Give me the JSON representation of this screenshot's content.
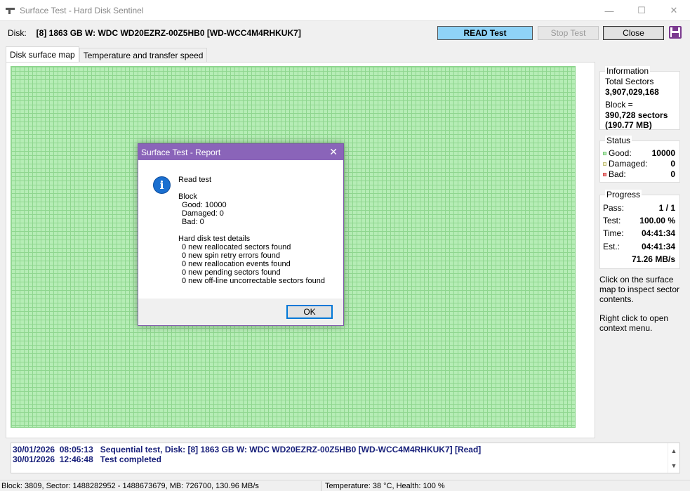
{
  "window": {
    "title": "Surface Test - Hard Disk Sentinel",
    "minimize": "—",
    "maximize": "☐",
    "close": "✕"
  },
  "disk": {
    "label": "Disk:",
    "name": "[8] 1863 GB W: WDC WD20EZRZ-00Z5HB0 [WD-WCC4M4RHKUK7]"
  },
  "toolbar": {
    "read_label": "READ Test",
    "stop_label": "Stop Test",
    "close_label": "Close"
  },
  "tabs": [
    {
      "label": "Disk surface map",
      "active": true
    },
    {
      "label": "Temperature and transfer speed",
      "active": false
    }
  ],
  "information": {
    "title": "Information",
    "total_label": "Total Sectors",
    "total_value": "3,907,029,168",
    "block_label": "Block =",
    "block_sectors": "390,728 sectors",
    "block_size": "(190.77 MB)"
  },
  "status": {
    "title": "Status",
    "good_label": "Good:",
    "good_value": "10000",
    "damaged_label": "Damaged:",
    "damaged_value": "0",
    "bad_label": "Bad:",
    "bad_value": "0"
  },
  "progress": {
    "title": "Progress",
    "pass_label": "Pass:",
    "pass_value": "1 / 1",
    "test_label": "Test:",
    "test_value": "100.00 %",
    "time_label": "Time:",
    "time_value": "04:41:34",
    "est_label": "Est.:",
    "est_value": "04:41:34",
    "speed": "71.26 MB/s"
  },
  "hints": {
    "click": "Click on the surface map to inspect sector contents.",
    "right_click": "Right click to open context menu."
  },
  "log": [
    {
      "date": "30/01/2026",
      "time": "08:05:13",
      "message": "Sequential test, Disk: [8] 1863 GB W: WDC WD20EZRZ-00Z5HB0 [WD-WCC4M4RHKUK7] [Read]"
    },
    {
      "date": "30/01/2026",
      "time": "12:46:48",
      "message": "Test completed"
    }
  ],
  "statusbar": {
    "left": "Block: 3809, Sector: 1488282952 - 1488673679, MB: 726700, 130.96 MB/s",
    "right": "Temperature: 38  °C,  Health: 100 %"
  },
  "dialog": {
    "title": "Surface Test - Report",
    "icon_glyph": "i",
    "heading": "Read test",
    "block_label": "Block",
    "good": "Good: 10000",
    "damaged": "Damaged: 0",
    "bad": "Bad: 0",
    "details_label": "Hard disk test details",
    "details": [
      "0 new reallocated sectors found",
      "0 new spin retry errors found",
      "0 new reallocation events found",
      "0 new pending sectors found",
      "0 new off-line uncorrectable sectors found"
    ],
    "ok_label": "OK"
  },
  "colors": {
    "good": "#b6edb6",
    "damaged": "#f7f2c6",
    "bad": "#f08a8a",
    "read_button": "#8fd3f7",
    "dialog_title": "#8a64b9",
    "log_text": "#18207a"
  }
}
